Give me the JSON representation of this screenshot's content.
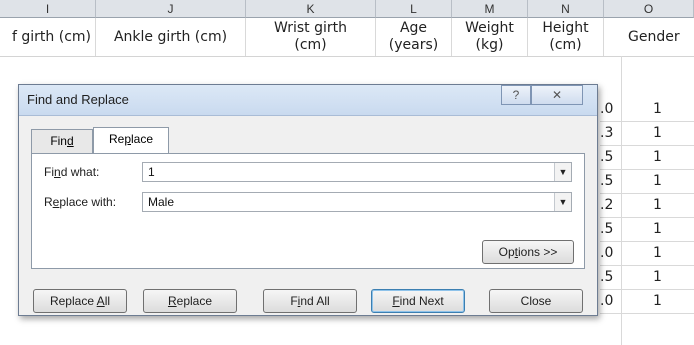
{
  "sheet": {
    "column_letters": [
      "I",
      "J",
      "K",
      "L",
      "M",
      "N",
      "O"
    ],
    "headers": {
      "I": "f girth (cm)",
      "J": "Ankle girth (cm)",
      "K": [
        "Wrist girth",
        "(cm)"
      ],
      "L": [
        "Age",
        "(years)"
      ],
      "M": [
        "Weight",
        "(kg)"
      ],
      "N": [
        "Height",
        "(cm)"
      ],
      "O": "Gender"
    },
    "col_N_fragments": [
      ".0",
      ".3",
      ".5",
      ".5",
      ".2",
      ".5",
      ".0",
      ".5",
      ".0"
    ],
    "col_O_values": [
      "1",
      "1",
      "1",
      "1",
      "1",
      "1",
      "1",
      "1",
      "1"
    ]
  },
  "dialog": {
    "title": "Find and Replace",
    "help_button": "?",
    "close_button": "✕",
    "tabs": [
      {
        "pre": "Fin",
        "u": "d",
        "post": ""
      },
      {
        "pre": "Re",
        "u": "p",
        "post": "lace"
      }
    ],
    "find_label": {
      "pre": "Fi",
      "u": "n",
      "post": "d what:"
    },
    "find_value": "1",
    "replace_label": {
      "pre": "R",
      "u": "e",
      "post": "place with:"
    },
    "replace_value": "Male",
    "options_button": {
      "pre": "Op",
      "u": "t",
      "post": "ions >>"
    },
    "buttons": {
      "replace_all": {
        "pre": "Replace ",
        "u": "A",
        "post": "ll"
      },
      "replace": {
        "pre": "",
        "u": "R",
        "post": "eplace"
      },
      "find_all": {
        "pre": "F",
        "u": "i",
        "post": "nd All"
      },
      "find_next": {
        "pre": "",
        "u": "F",
        "post": "ind Next"
      },
      "close": "Close"
    }
  }
}
